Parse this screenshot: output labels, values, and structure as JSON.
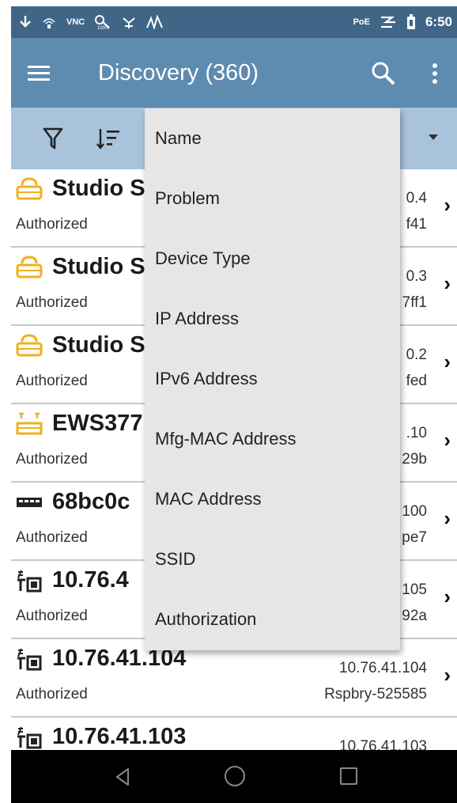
{
  "status_bar": {
    "vnc_label": "VNC",
    "poe_label": "PoE",
    "time": "6:50"
  },
  "app_bar": {
    "title": "Discovery (360)"
  },
  "sort_menu": {
    "items": [
      {
        "label": "Name"
      },
      {
        "label": "Problem"
      },
      {
        "label": "Device Type"
      },
      {
        "label": "IP Address"
      },
      {
        "label": "IPv6 Address"
      },
      {
        "label": "Mfg-MAC Address"
      },
      {
        "label": "MAC Address"
      },
      {
        "label": "SSID"
      },
      {
        "label": "Authorization"
      }
    ]
  },
  "list": {
    "rows": [
      {
        "name": "Studio S",
        "status": "Authorized",
        "ip": "0.4",
        "mac": "f41",
        "icon": "printer-icon"
      },
      {
        "name": "Studio S",
        "status": "Authorized",
        "ip": "0.3",
        "mac": "7ff1",
        "icon": "printer-icon"
      },
      {
        "name": "Studio S",
        "status": "Authorized",
        "ip": "0.2",
        "mac": "fed",
        "icon": "printer-icon"
      },
      {
        "name": "EWS377",
        "status": "Authorized",
        "ip": ".10",
        "mac": "29b",
        "icon": "access-point-icon"
      },
      {
        "name": "68bc0c",
        "status": "Authorized",
        "ip": "100",
        "mac": "pe7",
        "icon": "switch-icon"
      },
      {
        "name": "10.76.4",
        "status": "Authorized",
        "ip": "105",
        "mac": "92a",
        "icon": "host-icon"
      },
      {
        "name": "10.76.41.104",
        "status": "Authorized",
        "ip": "10.76.41.104",
        "mac": "Rspbry-525585",
        "icon": "host-icon"
      },
      {
        "name": "10.76.41.103",
        "status": "",
        "ip": "10.76.41.103",
        "mac": "",
        "icon": "host-icon"
      }
    ],
    "chevron": "›"
  },
  "colors": {
    "status_bar": "#3f6687",
    "app_bar": "#5e8bb0",
    "toolbar": "#a9c3da",
    "menu_bg": "#e6e6e6",
    "icon_yellow": "#f2b01e"
  }
}
